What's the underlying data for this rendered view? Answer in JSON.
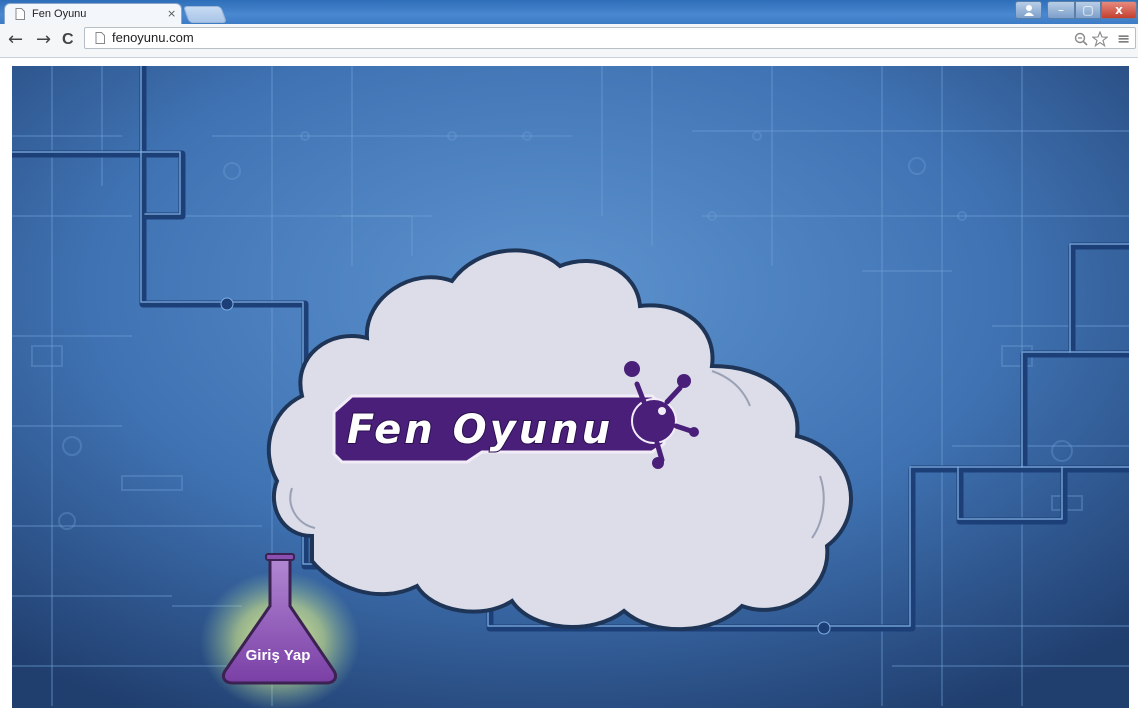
{
  "browser": {
    "tab_title": "Fen Oyunu",
    "tab_close": "×",
    "url": "fenoyunu.com",
    "nav": {
      "back": "←",
      "forward": "→",
      "reload": "C"
    },
    "omnibox_icons": {
      "zoom": "zoom-icon",
      "star": "star-icon"
    },
    "menu": "≡",
    "window_controls": {
      "user": "user-icon",
      "minimize": "–",
      "maximize": "▢",
      "close": "x"
    }
  },
  "page": {
    "logo_text": "Fen Oyunu",
    "login_button": "Giriş Yap"
  },
  "colors": {
    "background": "#3d6fb0",
    "cloud": "#dcdde8",
    "logo_purple": "#4a1f7a",
    "flask_purple": "#8a4fb0"
  }
}
